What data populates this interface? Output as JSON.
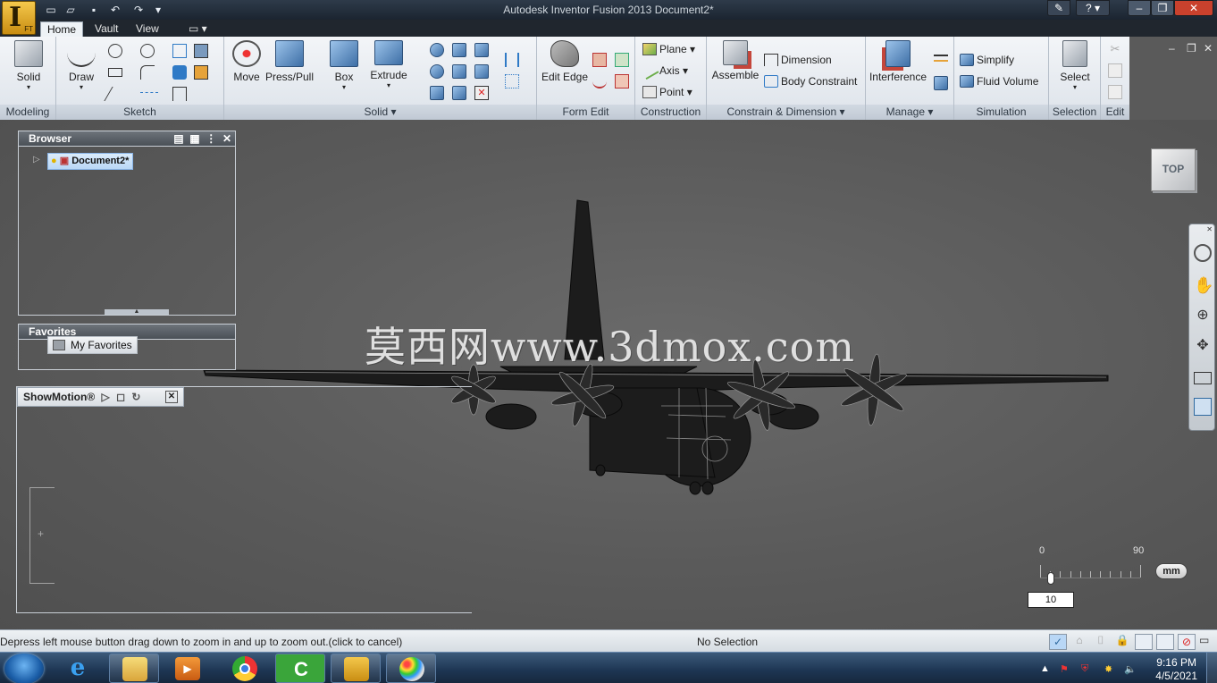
{
  "titlebar": {
    "title": "Autodesk Inventor Fusion 2013    Document2*",
    "logo_letter": "I",
    "logo_sub": "FT"
  },
  "tabs": [
    {
      "label": "Home",
      "active": true
    },
    {
      "label": "Vault",
      "active": false
    },
    {
      "label": "View",
      "active": false
    }
  ],
  "ribbon": {
    "panels": {
      "modeling": "Modeling",
      "sketch": "Sketch",
      "solid": "Solid",
      "form_edit": "Form Edit",
      "construction": "Construction",
      "constrain": "Constrain & Dimension",
      "manage": "Manage",
      "simulation": "Simulation",
      "selection": "Selection",
      "edit": "Edit"
    },
    "buttons": {
      "solid": "Solid",
      "draw": "Draw",
      "move": "Move",
      "press_pull": "Press/Pull",
      "box": "Box",
      "extrude": "Extrude",
      "edit_edge": "Edit Edge",
      "plane": "Plane",
      "axis": "Axis",
      "point": "Point",
      "assemble": "Assemble",
      "dimension": "Dimension",
      "body_constraint": "Body Constraint",
      "interference": "Interference",
      "simplify": "Simplify",
      "fluid_volume": "Fluid Volume",
      "select": "Select"
    }
  },
  "browser": {
    "title": "Browser",
    "document": "Document2*"
  },
  "favorites": {
    "title": "Favorites",
    "item": "My Favorites"
  },
  "showmotion": {
    "title": "ShowMotion®"
  },
  "viewcube": {
    "face": "TOP"
  },
  "ruler": {
    "min_label": "0",
    "max_label": "90",
    "unit": "mm",
    "value": "10"
  },
  "watermark": "莫西网www.3dmox.com",
  "status": {
    "message": "Depress left mouse button drag down to zoom in and up to zoom out.(click to cancel)",
    "selection": "No Selection"
  },
  "taskbar": {
    "time": "9:16 PM",
    "date": "4/5/2021"
  },
  "colors": {
    "ribbon_bg": "#e6ebf0",
    "viewport_bg": "#5a5a5a",
    "titlebar_bg": "#1f2833",
    "aircraft": "#1c1c1c"
  }
}
